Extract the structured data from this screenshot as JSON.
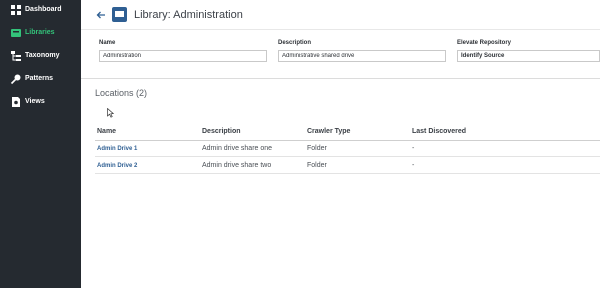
{
  "sidebar": {
    "items": [
      {
        "label": "Dashboard",
        "icon": "dashboard-icon",
        "active": false
      },
      {
        "label": "Libraries",
        "icon": "library-icon",
        "active": true
      },
      {
        "label": "Taxonomy",
        "icon": "taxonomy-icon",
        "active": false
      },
      {
        "label": "Patterns",
        "icon": "pattern-icon",
        "active": false
      },
      {
        "label": "Views",
        "icon": "document-icon",
        "active": false
      }
    ]
  },
  "header": {
    "title": "Library: Administration"
  },
  "form": {
    "name_label": "Name",
    "name_value": "Administration",
    "description_label": "Description",
    "description_value": "Administrative shared drive",
    "repository_label": "Elevate Repository",
    "repository_value": "Identify Source"
  },
  "locations": {
    "title": "Locations (2)",
    "columns": [
      "Name",
      "Description",
      "Crawler Type",
      "Last Discovered"
    ],
    "rows": [
      {
        "name": "Admin Drive 1",
        "description": "Admin drive share one",
        "crawler_type": "Folder",
        "last_discovered": "-"
      },
      {
        "name": "Admin Drive 2",
        "description": "Admin drive share two",
        "crawler_type": "Folder",
        "last_discovered": "-"
      }
    ]
  },
  "colors": {
    "sidebar_bg": "#252a30",
    "active_nav": "#33c37a",
    "link": "#2f5f93"
  }
}
